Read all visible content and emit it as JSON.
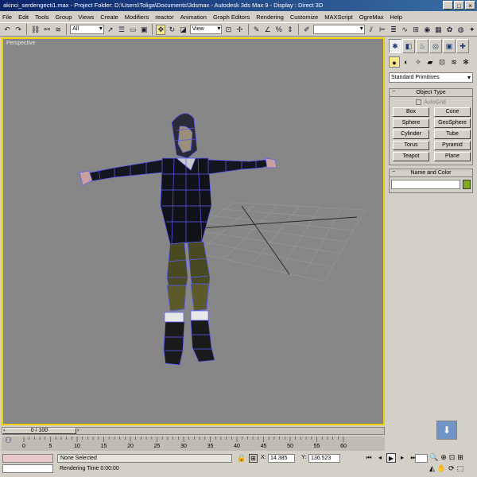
{
  "window": {
    "title": "akinci_serdengecti1.max    - Project Folder: D:\\Users\\Toliga\\Documents\\3dsmax    - Autodesk 3ds Max 9    - Display : Direct 3D"
  },
  "menu": [
    "File",
    "Edit",
    "Tools",
    "Group",
    "Views",
    "Create",
    "Modifiers",
    "reactor",
    "Animation",
    "Graph Editors",
    "Rendering",
    "Customize",
    "MAXScript",
    "OgreMax",
    "Help"
  ],
  "toolbar": {
    "selection_filter": "All",
    "reference_coord": "View"
  },
  "viewport": {
    "label": "Perspective",
    "background": "#878787",
    "active_border": "#f0d000"
  },
  "command_panel": {
    "category": "Standard Primitives",
    "object_type_title": "Object Type",
    "autogrid_label": "AutoGrid",
    "primitives": [
      "Box",
      "Cone",
      "Sphere",
      "GeoSphere",
      "Cylinder",
      "Tube",
      "Torus",
      "Pyramid",
      "Teapot",
      "Plane"
    ],
    "name_color_title": "Name and Color",
    "object_color": "#7fa818"
  },
  "time_slider": {
    "label": "0 / 100"
  },
  "trackbar": {
    "labels": [
      "0",
      "5",
      "10",
      "15",
      "20",
      "25",
      "30",
      "35",
      "40",
      "45",
      "50",
      "55",
      "60"
    ]
  },
  "status": {
    "selection": "None Selected",
    "prompt": "Rendering Time  0:00:00",
    "x_label": "X:",
    "x_value": "14.385",
    "y_label": "Y:",
    "y_value": "136.523"
  }
}
